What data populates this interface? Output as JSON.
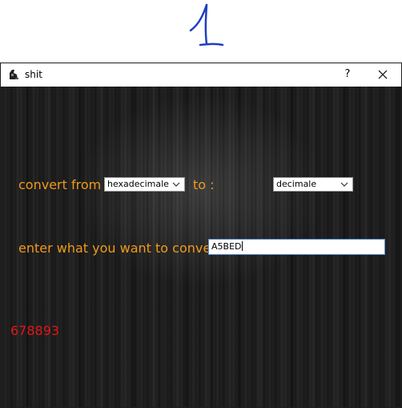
{
  "annotation": {
    "icon": "handwritten-number-one-icon",
    "color": "#1f3fbf"
  },
  "window": {
    "title": "shit",
    "help_label": "?",
    "close_icon": "close-icon"
  },
  "form": {
    "convert_from_label": "convert from :",
    "from_value": "hexadecimale",
    "to_label": "to :",
    "to_value": "decimale",
    "enter_label": "enter what you want to convert:",
    "input_value": "A5BED",
    "result": "678893"
  },
  "colors": {
    "label": "#f09a1c",
    "result": "#e01818",
    "background": "#1b1b1b"
  }
}
